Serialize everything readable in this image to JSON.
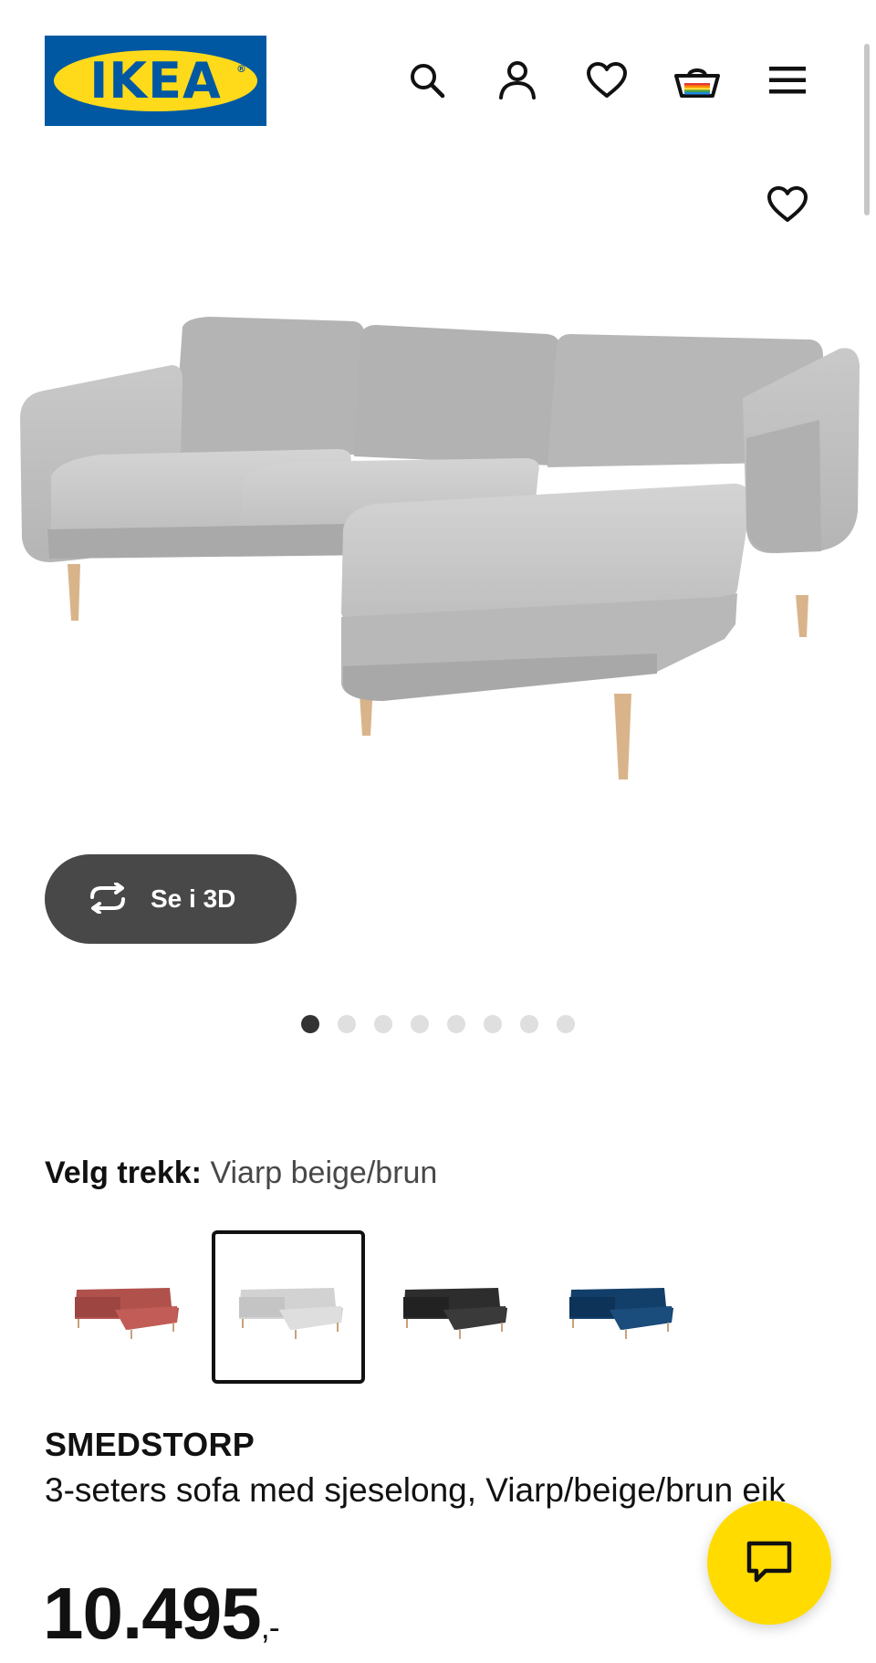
{
  "header": {
    "logo_text": "IKEA",
    "logo_mark": "®",
    "icons": [
      "search-icon",
      "account-icon",
      "favourites-icon",
      "cart-icon",
      "menu-icon"
    ],
    "brand_blue": "#0058a3",
    "brand_yellow": "#ffda1a"
  },
  "product_image": {
    "favourite_icon": "heart-outline-icon",
    "view_3d_label": "Se i 3D",
    "view_3d_icon": "rotate-3d-icon"
  },
  "carousel": {
    "total": 8,
    "active_index": 0
  },
  "fabric": {
    "label": "Velg trekk:",
    "selected_value": "Viarp beige/brun",
    "swatches": [
      {
        "name": "red-brown",
        "color": "#b0514c",
        "selected": false
      },
      {
        "name": "viarp-beige-brown",
        "color": "#d5d5d5",
        "selected": true
      },
      {
        "name": "black",
        "color": "#2d2d2d",
        "selected": false
      },
      {
        "name": "blue",
        "color": "#123f69",
        "selected": false
      }
    ]
  },
  "product": {
    "name": "SMEDSTORP",
    "description": "3-seters sofa med sjeselong, Viarp/beige/brun eik",
    "price": "10.495",
    "price_suffix": ",-"
  },
  "chat": {
    "icon": "chat-bubble-icon",
    "color": "#ffdb00"
  }
}
